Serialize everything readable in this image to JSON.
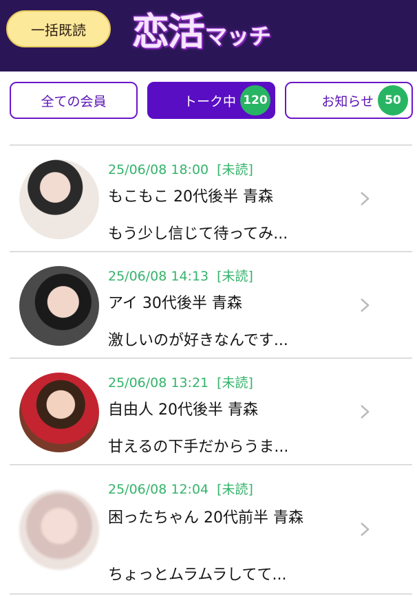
{
  "header": {
    "bulk_read_label": "一括既読",
    "logo_main": "恋活",
    "logo_sub": "マッチ"
  },
  "tabs": [
    {
      "label": "全ての会員",
      "badge": null,
      "active": false
    },
    {
      "label": "トーク中",
      "badge": "120",
      "active": true
    },
    {
      "label": "お知らせ",
      "badge": "50",
      "active": false
    }
  ],
  "conversations": [
    {
      "timestamp": "25/06/08 18:00",
      "status": "[未読]",
      "name": "もこもこ 20代後半 青森",
      "preview": "もう少し信じて待ってみ..."
    },
    {
      "timestamp": "25/06/08 14:13",
      "status": "[未読]",
      "name": "アイ 30代後半 青森",
      "preview": "激しいのが好きなんです..."
    },
    {
      "timestamp": "25/06/08 13:21",
      "status": "[未読]",
      "name": "自由人 20代後半 青森",
      "preview": "甘えるの下手だからうま..."
    },
    {
      "timestamp": "25/06/08 12:04",
      "status": "[未読]",
      "name": "困ったちゃん 20代前半 青森",
      "preview": "ちょっとムラムラしてて..."
    }
  ],
  "colors": {
    "header_bg": "#2a1656",
    "accent_purple": "#5a0ec4",
    "badge_green": "#28b563",
    "timestamp_green": "#34b36b",
    "bulk_button_yellow": "#fde99a"
  },
  "icons": {
    "chevron": "chevron-right-icon"
  }
}
